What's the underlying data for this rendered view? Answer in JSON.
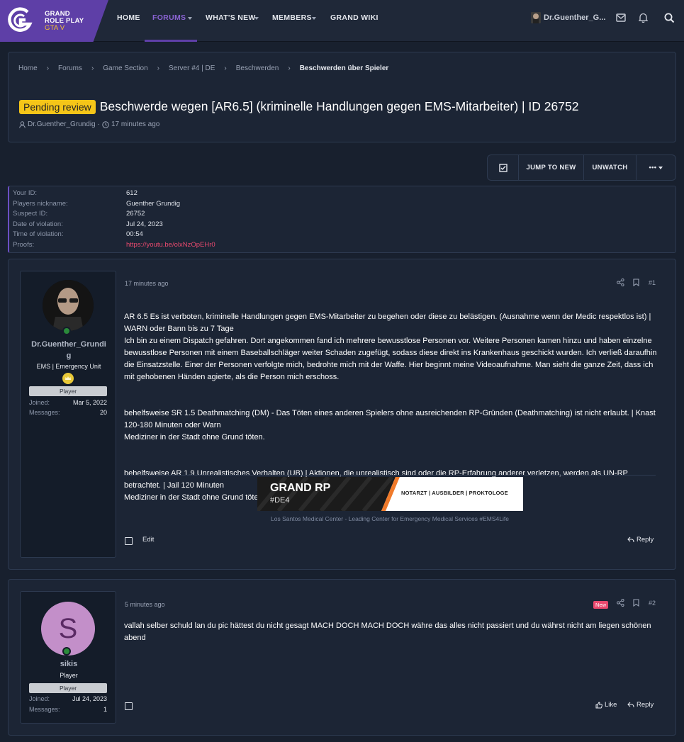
{
  "brand": {
    "line1": "GRAND",
    "line2": "ROLE PLAY",
    "line3": "GTA V"
  },
  "nav": {
    "home": "HOME",
    "forums": "FORUMS",
    "whats_new": "WHAT'S NEW",
    "members": "MEMBERS",
    "wiki": "GRAND WIKI",
    "username": "Dr.Guenther_G..."
  },
  "breadcrumb": [
    "Home",
    "Forums",
    "Game Section",
    "Server #4 | DE",
    "Beschwerden",
    "Beschwerden über Spieler"
  ],
  "thread": {
    "prefix": "Pending review",
    "title": "Beschwerde wegen [AR6.5] (kriminelle Handlungen gegen EMS-Mitarbeiter) | ID 26752",
    "author": "Dr.Guenther_Grundig",
    "time": "17 minutes ago"
  },
  "actions": {
    "jump": "JUMP TO NEW",
    "unwatch": "UNWATCH",
    "more": "•••"
  },
  "info": [
    {
      "label": "Your ID:",
      "value": "612"
    },
    {
      "label": "Players nickname:",
      "value": "Guenther Grundig"
    },
    {
      "label": "Suspect ID:",
      "value": "26752"
    },
    {
      "label": "Date of violation:",
      "value": "Jul 24, 2023"
    },
    {
      "label": "Time of violation:",
      "value": "00:54"
    },
    {
      "label": "Proofs:",
      "value": "https://youtu.be/olxNzOpEHr0"
    }
  ],
  "post1": {
    "user": {
      "name_line1": "Dr.Guenther_Grundi",
      "name_line2": "g",
      "title": "EMS | Emergency Unit",
      "banner": "Player",
      "joined_label": "Joined:",
      "joined": "Mar 5, 2022",
      "messages_label": "Messages:",
      "messages": "20"
    },
    "time": "17 minutes ago",
    "number": "#1",
    "paragraphs": [
      "AR 6.5 Es ist verboten, kriminelle Handlungen gegen EMS-Mitarbeiter zu begehen oder diese zu belästigen. (Ausnahme wenn der Medic respektlos ist) | WARN oder Bann bis zu 7 Tage\nIch bin zu einem Dispatch gefahren. Dort angekommen fand ich mehrere bewusstlose Personen vor. Weitere Personen kamen hinzu und haben einzelne bewusstlose Personen mit einem Baseballschläger weiter Schaden zugefügt, sodass diese direkt ins Krankenhaus geschickt wurden. Ich verließ daraufhin die Einsatzstelle. Einer der Personen verfolgte mich, bedrohte mich mit der Waffe. Hier beginnt meine Videoaufnahme. Man sieht die ganze Zeit, dass ich mit gehobenen Händen agierte, als die Person mich erschoss.",
      "behelfsweise SR 1.5 Deathmatching (DM) - Das Töten eines anderen Spielers ohne ausreichenden RP-Gründen (Deathmatching) ist nicht erlaubt. | Knast 120-180 Minuten oder Warn\nMediziner in der Stadt ohne Grund töten.",
      "behelfsweise AR 1.9 Unrealistisches Verhalten (UB) | Aktionen, die unrealistisch sind oder die RP-Erfahrung anderer verletzen, werden als UN-RP betrachtet. | Jail 120 Minuten\nMediziner in der Stadt ohne Grund töten."
    ],
    "signature": {
      "banner_title": "GRAND RP",
      "banner_sub": "#DE4",
      "banner_right": "NOTARZT | AUSBILDER | PROKTOLOGE",
      "caption": "Los Santos Medical Center - Leading Center for Emergency Medical Services #EMS4Life"
    },
    "edit": "Edit",
    "reply": "Reply"
  },
  "post2": {
    "user": {
      "initial": "S",
      "name": "sikis",
      "title": "Player",
      "banner": "Player",
      "joined_label": "Joined:",
      "joined": "Jul 24, 2023",
      "messages_label": "Messages:",
      "messages": "1"
    },
    "time": "5 minutes ago",
    "number": "#2",
    "new": "New",
    "body": "vallah selber schuld lan du pic hättest du nicht gesagt MACH DOCH MACH DOCH währe das alles nicht passiert und du währst nicht am liegen schönen abend",
    "like": "Like",
    "reply": "Reply"
  },
  "colors": {
    "accent": "#5e3fa7",
    "pending": "#f5c518",
    "link": "#e8496e",
    "avatar2": "#c38fc9"
  }
}
